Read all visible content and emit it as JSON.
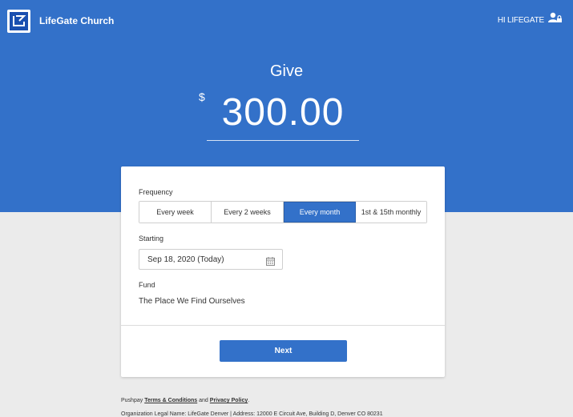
{
  "header": {
    "church_name": "LifeGate Church",
    "greeting": "HI LIFEGATE",
    "logo_icon": "lifegate-logo-icon",
    "user_icon": "user-lock-icon"
  },
  "give": {
    "title": "Give",
    "currency_symbol": "$",
    "amount": "300.00"
  },
  "form": {
    "frequency_label": "Frequency",
    "frequency_options": [
      "Every week",
      "Every 2 weeks",
      "Every month",
      "1st & 15th monthly"
    ],
    "frequency_selected": "Every month",
    "starting_label": "Starting",
    "starting_value": "Sep 18, 2020 (Today)",
    "calendar_icon": "calendar-icon",
    "fund_label": "Fund",
    "fund_value": "The Place We Find Ourselves",
    "next_label": "Next"
  },
  "footer": {
    "prefix": "Pushpay",
    "terms_link": "Terms & Conditions",
    "and_text": "and",
    "privacy_link": "Privacy Policy",
    "suffix": ".",
    "legal_line": "Organization Legal Name: LifeGate Denver  |  Address: 12000 E Circuit Ave, Building D, Denver CO 80231"
  },
  "colors": {
    "brand_blue": "#3371c9",
    "page_background": "#ebebeb",
    "card_background": "#ffffff"
  }
}
